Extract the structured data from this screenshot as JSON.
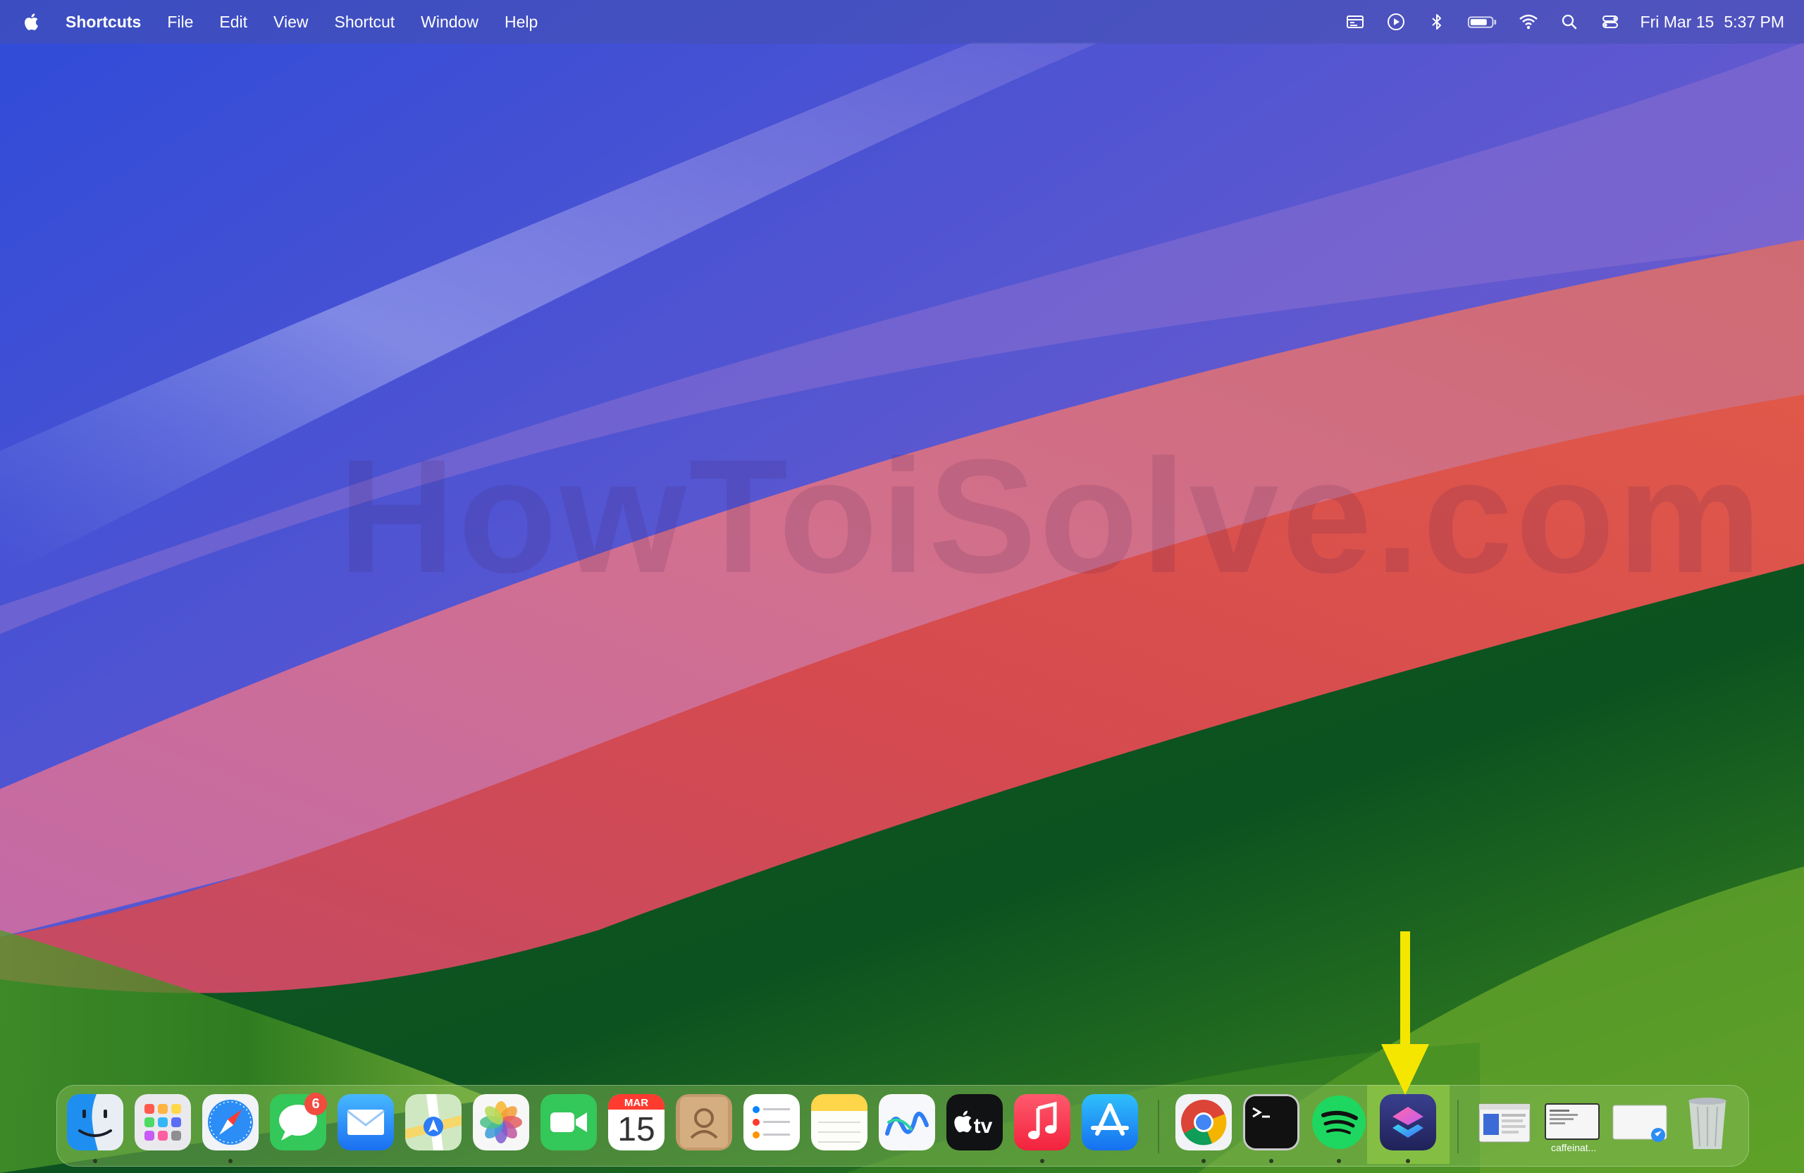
{
  "menubar": {
    "app_name": "Shortcuts",
    "items": [
      "File",
      "Edit",
      "View",
      "Shortcut",
      "Window",
      "Help"
    ],
    "clock": {
      "date": "Fri Mar 15",
      "time": "5:37 PM"
    },
    "status_icons": [
      "media-icon",
      "play-icon",
      "bluetooth-icon",
      "battery-icon",
      "wifi-icon",
      "search-icon",
      "control-center-icon"
    ]
  },
  "watermark": "HowToiSolve.com",
  "dock": {
    "apps": [
      {
        "name": "Finder",
        "icon": "finder-icon",
        "running": true
      },
      {
        "name": "Launchpad",
        "icon": "launchpad-icon",
        "running": false
      },
      {
        "name": "Safari",
        "icon": "safari-icon",
        "running": true
      },
      {
        "name": "Messages",
        "icon": "messages-icon",
        "running": false,
        "badge": "6"
      },
      {
        "name": "Mail",
        "icon": "mail-icon",
        "running": false
      },
      {
        "name": "Maps",
        "icon": "maps-icon",
        "running": false
      },
      {
        "name": "Photos",
        "icon": "photos-icon",
        "running": false
      },
      {
        "name": "FaceTime",
        "icon": "facetime-icon",
        "running": false
      },
      {
        "name": "Calendar",
        "icon": "calendar-icon",
        "running": false,
        "month": "MAR",
        "day": "15"
      },
      {
        "name": "Contacts",
        "icon": "contacts-icon",
        "running": false
      },
      {
        "name": "Reminders",
        "icon": "reminders-icon",
        "running": false
      },
      {
        "name": "Notes",
        "icon": "notes-icon",
        "running": false
      },
      {
        "name": "Freeform",
        "icon": "freeform-icon",
        "running": false
      },
      {
        "name": "TV",
        "icon": "apple-tv-icon",
        "running": false,
        "label": "tv"
      },
      {
        "name": "Music",
        "icon": "music-icon",
        "running": true
      },
      {
        "name": "App Store",
        "icon": "app-store-icon",
        "running": false
      },
      {
        "name": "Google Chrome",
        "icon": "chrome-icon",
        "running": true
      },
      {
        "name": "Terminal",
        "icon": "terminal-icon",
        "running": true
      },
      {
        "name": "Spotify",
        "icon": "spotify-icon",
        "running": true
      },
      {
        "name": "Shortcuts",
        "icon": "shortcuts-icon",
        "running": true,
        "highlighted": true
      }
    ],
    "recent": [
      {
        "name": "Preview window thumbnail",
        "icon": "window-thumbnail-icon"
      },
      {
        "name": "caffeinate thumbnail",
        "icon": "window-thumbnail-icon",
        "label": "caffeinat..."
      },
      {
        "name": "Safari window thumbnail",
        "icon": "window-thumbnail-icon"
      },
      {
        "name": "Trash",
        "icon": "trash-icon"
      }
    ]
  },
  "annotation": {
    "arrow_color": "#f5e600",
    "highlight_color": "#aae63c"
  }
}
